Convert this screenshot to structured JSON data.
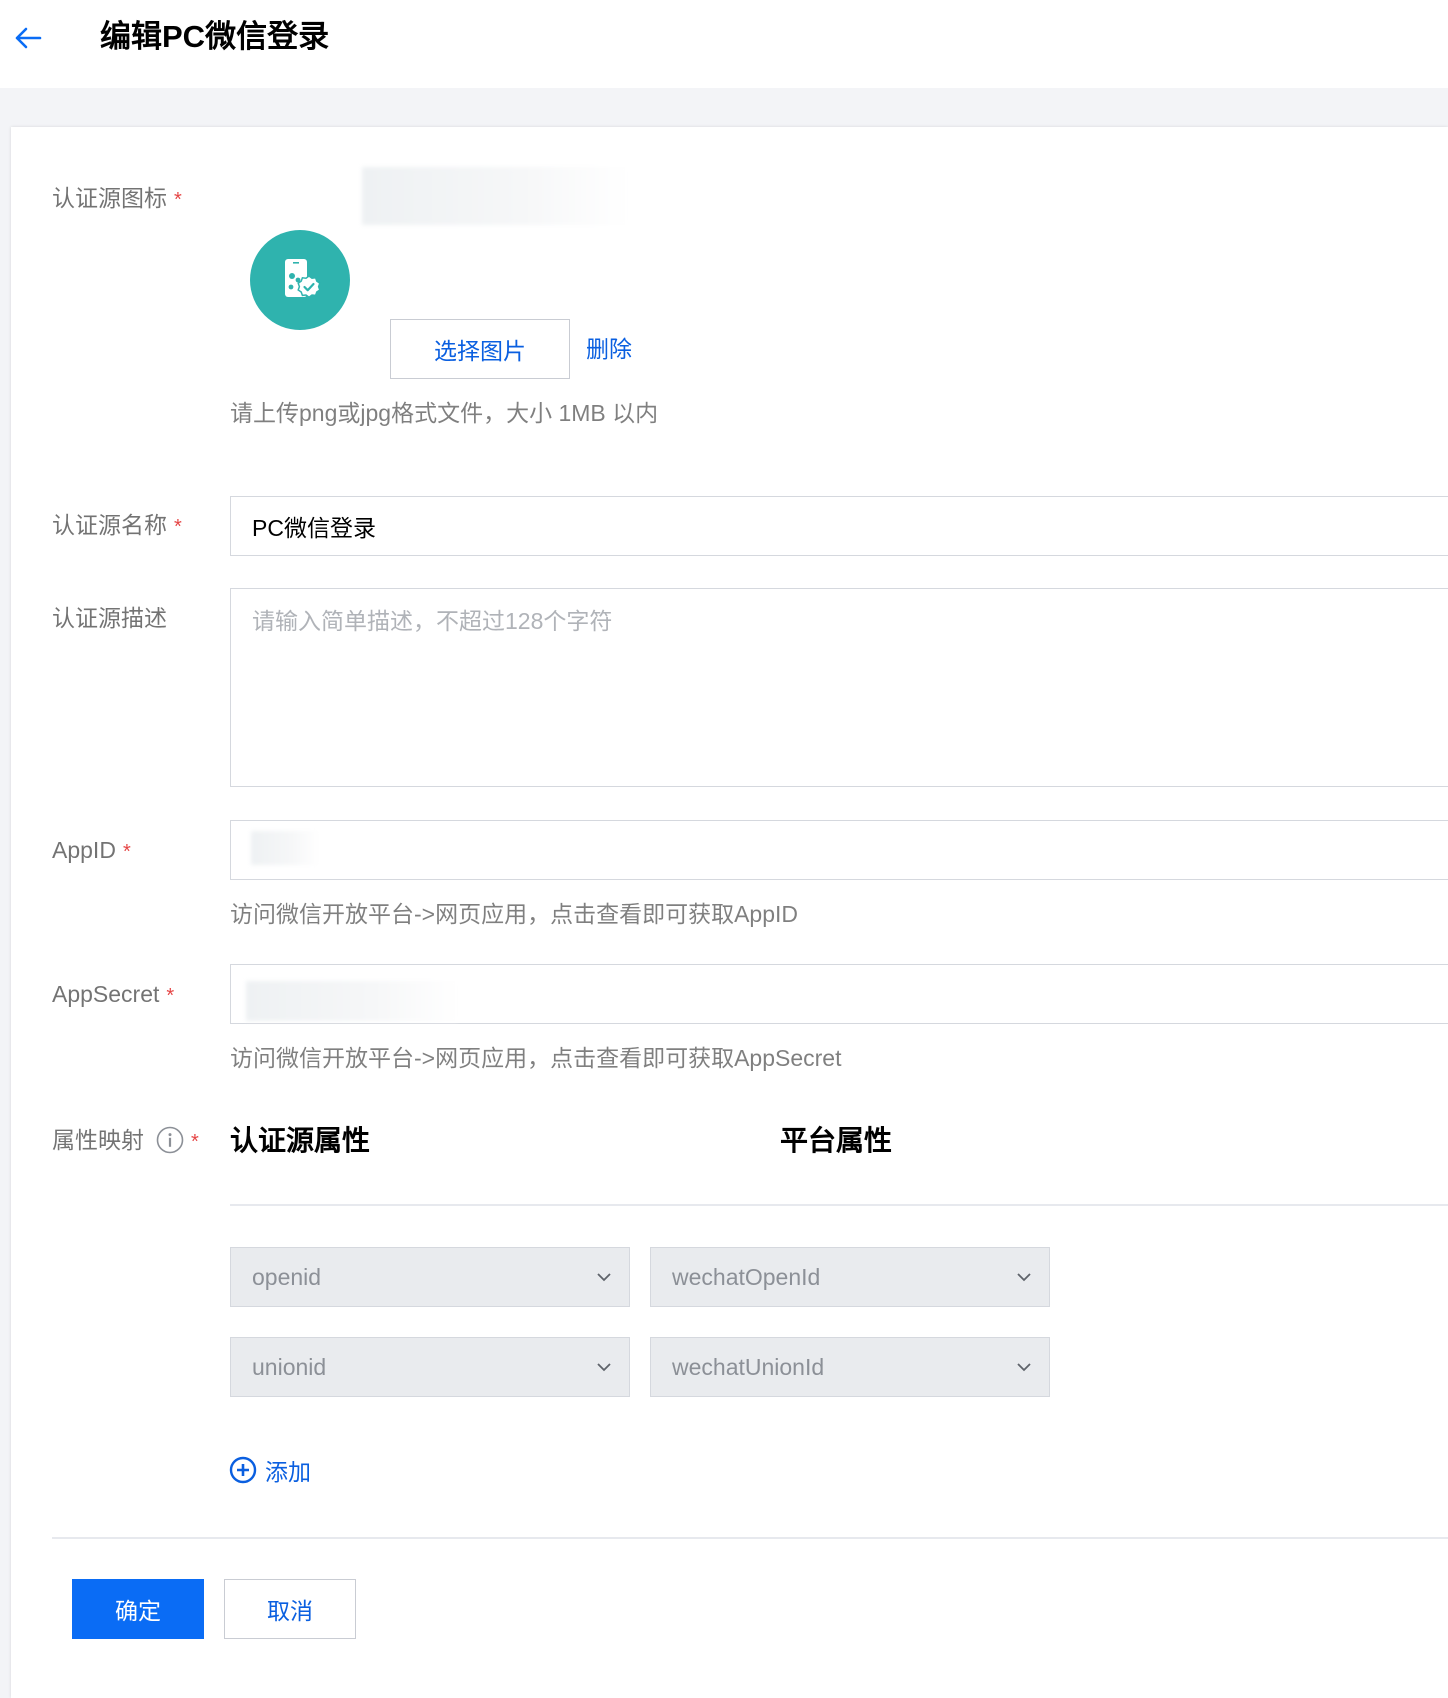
{
  "header": {
    "title": "编辑PC微信登录"
  },
  "form": {
    "icon": {
      "label": "认证源图标",
      "select_button": "选择图片",
      "delete_link": "删除",
      "hint": "请上传png或jpg格式文件，大小 1MB 以内"
    },
    "name": {
      "label": "认证源名称",
      "value": "PC微信登录"
    },
    "description": {
      "label": "认证源描述",
      "placeholder": "请输入简单描述，不超过128个字符"
    },
    "appid": {
      "label": "AppID",
      "hint": "访问微信开放平台->网页应用，点击查看即可获取AppID"
    },
    "appsecret": {
      "label": "AppSecret",
      "hint": "访问微信开放平台->网页应用，点击查看即可获取AppSecret"
    },
    "required_mark": "*",
    "mapping": {
      "label": "属性映射",
      "col_source": "认证源属性",
      "col_platform": "平台属性",
      "rows": [
        {
          "source": "openid",
          "platform": "wechatOpenId"
        },
        {
          "source": "unionid",
          "platform": "wechatUnionId"
        }
      ],
      "add_label": "添加"
    }
  },
  "footer": {
    "confirm": "确定",
    "cancel": "取消"
  },
  "colors": {
    "primary": "#0a6cf5",
    "link": "#0a5fe0",
    "required": "#e54545",
    "avatar": "#2fb3ae"
  }
}
